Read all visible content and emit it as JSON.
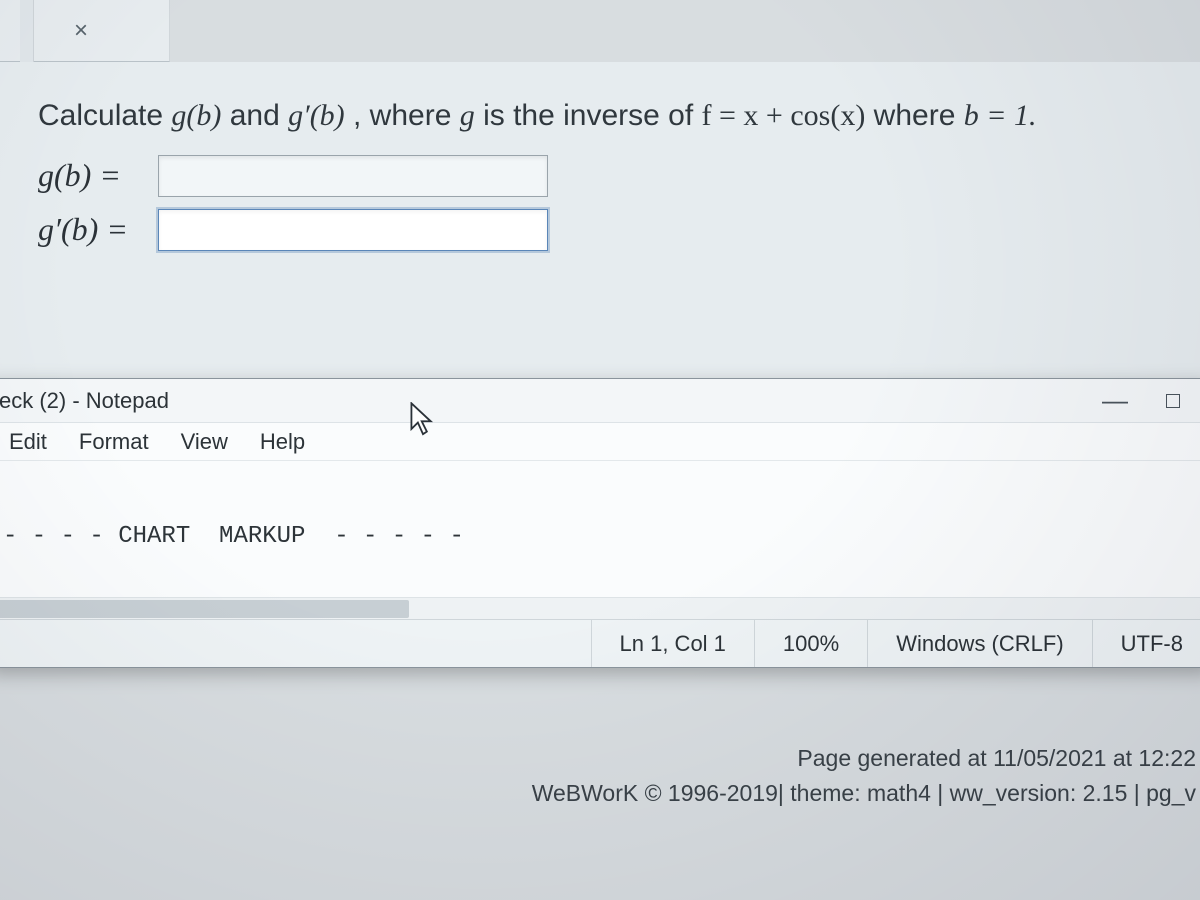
{
  "tab": {
    "close_glyph": "×"
  },
  "problem": {
    "prompt_prefix": "Calculate ",
    "g_of_b": "g(b)",
    "and": " and ",
    "gprime_of_b": "g′(b)",
    "mid": ", where ",
    "g_var": "g",
    "is_inverse": " is the inverse of ",
    "f_eq": "f = x + cos(x)",
    "where": " where ",
    "b_eq": "b = 1.",
    "row1_label": "g(b) =",
    "row2_label": "g′(b) =",
    "row1_value": "",
    "row2_value": ""
  },
  "notepad": {
    "title": "eck (2) - Notepad",
    "menu": {
      "edit": "Edit",
      "format": "Format",
      "view": "View",
      "help": "Help"
    },
    "content_line1": "- - - - CHART  MARKUP  - - - - -",
    "status": {
      "position": "Ln 1, Col 1",
      "zoom": "100%",
      "eol": "Windows (CRLF)",
      "encoding": "UTF-8"
    },
    "window_controls": {
      "min": "—"
    }
  },
  "footer": {
    "generated": "Page generated at 11/05/2021 at 12:22",
    "credits": "WeBWorK © 1996-2019| theme: math4 | ww_version: 2.15 | pg_v"
  }
}
